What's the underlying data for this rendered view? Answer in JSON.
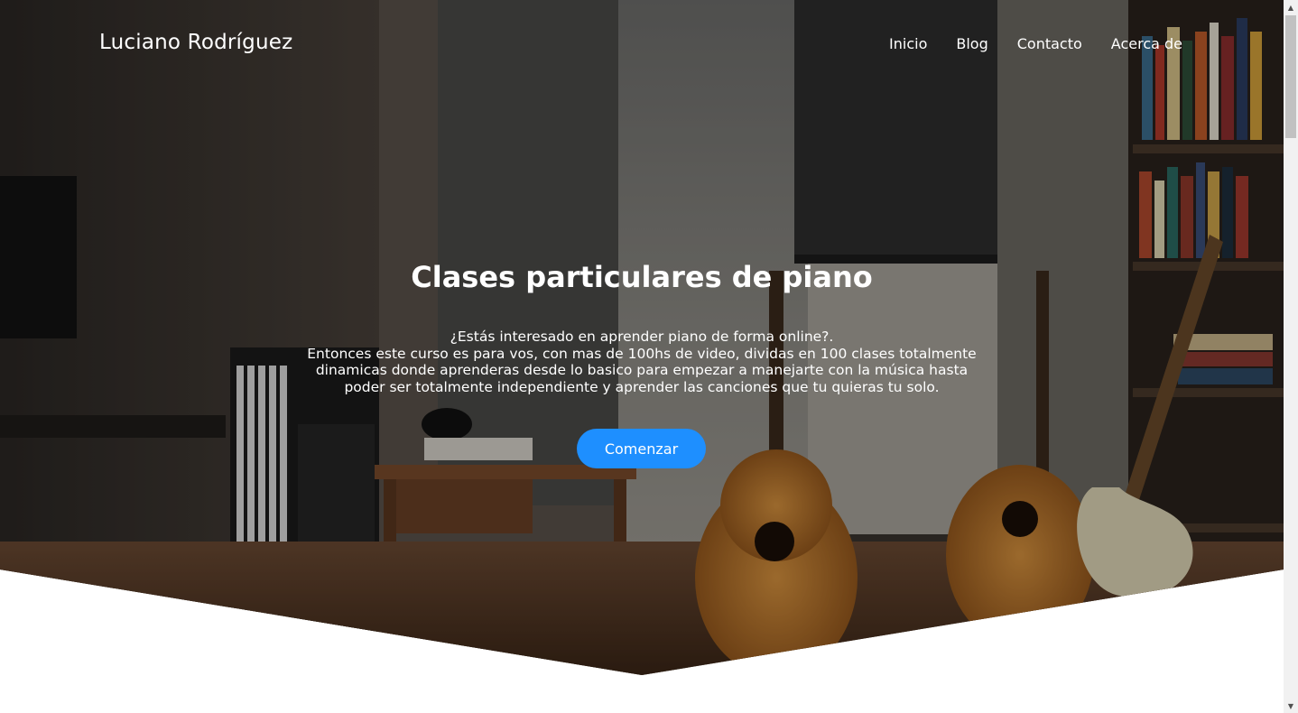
{
  "header": {
    "brand": "Luciano Rodríguez",
    "nav": [
      "Inicio",
      "Blog",
      "Contacto",
      "Acerca de"
    ]
  },
  "hero": {
    "title": "Clases particulares de piano",
    "lines": [
      "¿Estás interesado en aprender piano de forma online?.",
      "Entonces este curso es para vos, con mas de 100hs de video, dividas en 100 clases totalmente",
      "dinamicas donde aprenderas desde lo basico para empezar a manejarte con la música hasta",
      "poder ser totalmente independiente y aprender las canciones que tu quieras tu solo."
    ],
    "cta_label": "Comenzar",
    "background_image": "music-room-photo"
  },
  "scrollbar": {
    "up_icon": "scroll-up-arrow-icon",
    "down_icon": "scroll-down-arrow-icon"
  },
  "colors": {
    "accent": "#1e8fff",
    "text": "#ffffff"
  }
}
